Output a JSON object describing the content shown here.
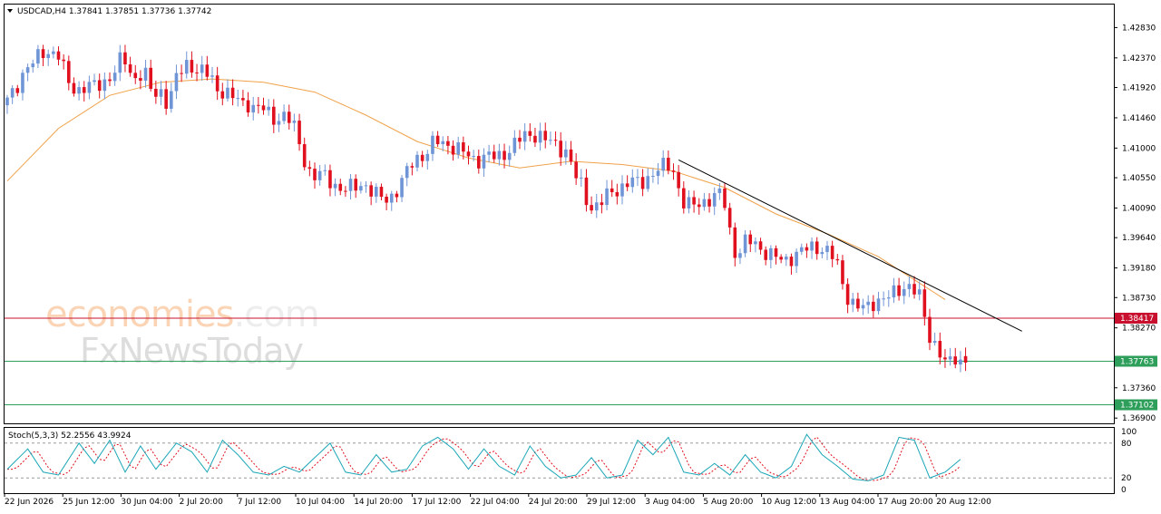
{
  "header": {
    "symbol": "USDCAD,H4",
    "open": "1.37841",
    "high": "1.37851",
    "low": "1.37736",
    "close": "1.37742"
  },
  "watermark": {
    "line1a": "economies",
    "line1b": ".com",
    "line2": "FxNewsToday"
  },
  "colors": {
    "bull": "#6f95d6",
    "bear": "#e0101e",
    "ma": "#f0a24a",
    "resistance": "#c8102e",
    "support": "#2e9e5b",
    "trendline": "#000000",
    "stoch_main": "#1aa6b7",
    "stoch_signal": "#e0101e"
  },
  "chart_data": {
    "type": "candlestick",
    "symbol": "USDCAD",
    "timeframe": "H4",
    "x_tick_labels": [
      "22 Jun 2026",
      "25 Jun 12:00",
      "30 Jun 04:00",
      "2 Jul 20:00",
      "7 Jul 12:00",
      "10 Jul 04:00",
      "14 Jul 20:00",
      "17 Jul 12:00",
      "22 Jul 04:00",
      "24 Jul 20:00",
      "29 Jul 12:00",
      "3 Aug 04:00",
      "5 Aug 20:00",
      "10 Aug 12:00",
      "13 Aug 04:00",
      "17 Aug 20:00",
      "20 Aug 12:00"
    ],
    "y_tick_labels": [
      "1.42830",
      "1.42370",
      "1.41920",
      "1.41460",
      "1.41000",
      "1.40550",
      "1.40090",
      "1.39640",
      "1.39180",
      "1.38730",
      "1.38270",
      "1.37360",
      "1.36900"
    ],
    "ylim": [
      1.3682,
      1.4318
    ],
    "price_path": [
      [
        0,
        1.4165
      ],
      [
        2,
        1.4188
      ],
      [
        4,
        1.4222
      ],
      [
        6,
        1.4232
      ],
      [
        8,
        1.4248
      ],
      [
        10,
        1.4245
      ],
      [
        11,
        1.4238
      ],
      [
        12,
        1.42
      ],
      [
        14,
        1.4188
      ],
      [
        16,
        1.4195
      ],
      [
        18,
        1.4192
      ],
      [
        20,
        1.4205
      ],
      [
        22,
        1.4222
      ],
      [
        23,
        1.424
      ],
      [
        25,
        1.4205
      ],
      [
        26,
        1.4212
      ],
      [
        27,
        1.4215
      ],
      [
        28,
        1.4205
      ],
      [
        29,
        1.417
      ],
      [
        30,
        1.419
      ],
      [
        31,
        1.4182
      ],
      [
        32,
        1.4165
      ],
      [
        33,
        1.42
      ],
      [
        35,
        1.4222
      ],
      [
        36,
        1.4232
      ],
      [
        37,
        1.4218
      ],
      [
        38,
        1.4222
      ],
      [
        39,
        1.421
      ],
      [
        40,
        1.4212
      ],
      [
        41,
        1.4195
      ],
      [
        42,
        1.4182
      ],
      [
        43,
        1.4195
      ],
      [
        44,
        1.4172
      ],
      [
        45,
        1.418
      ],
      [
        46,
        1.4165
      ],
      [
        48,
        1.417
      ],
      [
        49,
        1.4158
      ],
      [
        50,
        1.4165
      ],
      [
        51,
        1.4152
      ],
      [
        52,
        1.415
      ],
      [
        53,
        1.414
      ],
      [
        54,
        1.4155
      ],
      [
        55,
        1.4145
      ],
      [
        56,
        1.414
      ],
      [
        57,
        1.412
      ],
      [
        58,
        1.4092
      ],
      [
        60,
        1.4055
      ],
      [
        62,
        1.406
      ],
      [
        64,
        1.4048
      ],
      [
        66,
        1.4035
      ],
      [
        68,
        1.404
      ],
      [
        70,
        1.4048
      ],
      [
        72,
        1.403
      ],
      [
        74,
        1.4022
      ],
      [
        76,
        1.403
      ],
      [
        78,
        1.4055
      ],
      [
        80,
        1.4085
      ],
      [
        82,
        1.409
      ],
      [
        84,
        1.411
      ],
      [
        86,
        1.4108
      ],
      [
        88,
        1.41
      ],
      [
        90,
        1.409
      ],
      [
        92,
        1.4082
      ],
      [
        94,
        1.4088
      ],
      [
        96,
        1.4085
      ],
      [
        98,
        1.4095
      ],
      [
        100,
        1.411
      ],
      [
        102,
        1.412
      ],
      [
        104,
        1.4122
      ],
      [
        106,
        1.411
      ],
      [
        108,
        1.4102
      ],
      [
        110,
        1.4095
      ],
      [
        111,
        1.406
      ],
      [
        112,
        1.405
      ],
      [
        113,
        1.4035
      ],
      [
        114,
        1.401
      ],
      [
        116,
        1.4015
      ],
      [
        118,
        1.403
      ],
      [
        120,
        1.404
      ],
      [
        122,
        1.405
      ],
      [
        124,
        1.4045
      ],
      [
        126,
        1.406
      ],
      [
        128,
        1.407
      ],
      [
        130,
        1.4072
      ],
      [
        131,
        1.406
      ],
      [
        132,
        1.402
      ],
      [
        134,
        1.401
      ],
      [
        136,
        1.4018
      ],
      [
        138,
        1.4025
      ],
      [
        140,
        1.403
      ],
      [
        141,
        1.4
      ],
      [
        142,
        1.395
      ],
      [
        143,
        1.3935
      ],
      [
        144,
        1.3955
      ],
      [
        146,
        1.3958
      ],
      [
        148,
        1.3945
      ],
      [
        150,
        1.3935
      ],
      [
        152,
        1.3928
      ],
      [
        154,
        1.3938
      ],
      [
        156,
        1.3945
      ],
      [
        158,
        1.395
      ],
      [
        160,
        1.3948
      ],
      [
        162,
        1.393
      ],
      [
        163,
        1.391
      ],
      [
        164,
        1.388
      ],
      [
        166,
        1.386
      ],
      [
        168,
        1.3855
      ],
      [
        170,
        1.387
      ],
      [
        172,
        1.3872
      ],
      [
        174,
        1.388
      ],
      [
        176,
        1.3895
      ],
      [
        178,
        1.388
      ],
      [
        179,
        1.3865
      ],
      [
        180,
        1.382
      ],
      [
        181,
        1.3808
      ],
      [
        182,
        1.38
      ],
      [
        183,
        1.378
      ],
      [
        184,
        1.3765
      ],
      [
        185,
        1.3782
      ],
      [
        186,
        1.378
      ],
      [
        187,
        1.3774
      ]
    ],
    "moving_average": [
      [
        0,
        1.405
      ],
      [
        10,
        1.413
      ],
      [
        20,
        1.418
      ],
      [
        30,
        1.42
      ],
      [
        40,
        1.4205
      ],
      [
        50,
        1.42
      ],
      [
        60,
        1.4185
      ],
      [
        70,
        1.415
      ],
      [
        80,
        1.411
      ],
      [
        90,
        1.4085
      ],
      [
        100,
        1.407
      ],
      [
        110,
        1.408
      ],
      [
        120,
        1.4075
      ],
      [
        130,
        1.4065
      ],
      [
        140,
        1.404
      ],
      [
        150,
        1.4
      ],
      [
        160,
        1.397
      ],
      [
        170,
        1.3935
      ],
      [
        175,
        1.391
      ],
      [
        180,
        1.3885
      ],
      [
        183,
        1.387
      ]
    ],
    "horizontal_levels": [
      {
        "label": "1.38417",
        "value": 1.38417,
        "kind": "resistance"
      },
      {
        "label": "1.37763",
        "value": 1.37763,
        "kind": "support"
      },
      {
        "label": "1.37102",
        "value": 1.37102,
        "kind": "support"
      }
    ],
    "trendline": {
      "from": [
        131,
        1.4082
      ],
      "to": [
        198,
        1.3822
      ]
    },
    "stochastic": {
      "label": "Stoch(5,3,3) 52.2556 43.9924",
      "ylim": [
        0,
        100
      ],
      "levels": [
        20,
        80
      ],
      "tick_labels": [
        "100",
        "80",
        "20",
        "0"
      ],
      "k_path": [
        [
          0,
          35
        ],
        [
          4,
          70
        ],
        [
          7,
          30
        ],
        [
          10,
          25
        ],
        [
          14,
          80
        ],
        [
          17,
          45
        ],
        [
          20,
          85
        ],
        [
          23,
          30
        ],
        [
          26,
          75
        ],
        [
          29,
          35
        ],
        [
          33,
          80
        ],
        [
          36,
          65
        ],
        [
          39,
          30
        ],
        [
          42,
          85
        ],
        [
          45,
          60
        ],
        [
          48,
          30
        ],
        [
          51,
          25
        ],
        [
          54,
          40
        ],
        [
          57,
          30
        ],
        [
          60,
          55
        ],
        [
          63,
          80
        ],
        [
          66,
          30
        ],
        [
          69,
          25
        ],
        [
          72,
          60
        ],
        [
          75,
          30
        ],
        [
          78,
          35
        ],
        [
          81,
          75
        ],
        [
          84,
          90
        ],
        [
          87,
          70
        ],
        [
          90,
          35
        ],
        [
          93,
          70
        ],
        [
          96,
          40
        ],
        [
          99,
          25
        ],
        [
          102,
          75
        ],
        [
          105,
          40
        ],
        [
          108,
          20
        ],
        [
          111,
          25
        ],
        [
          114,
          55
        ],
        [
          117,
          20
        ],
        [
          120,
          25
        ],
        [
          123,
          85
        ],
        [
          126,
          60
        ],
        [
          129,
          90
        ],
        [
          132,
          30
        ],
        [
          135,
          25
        ],
        [
          138,
          45
        ],
        [
          141,
          25
        ],
        [
          144,
          60
        ],
        [
          147,
          30
        ],
        [
          150,
          20
        ],
        [
          153,
          40
        ],
        [
          156,
          95
        ],
        [
          159,
          60
        ],
        [
          162,
          40
        ],
        [
          165,
          18
        ],
        [
          168,
          15
        ],
        [
          171,
          25
        ],
        [
          174,
          90
        ],
        [
          177,
          85
        ],
        [
          180,
          20
        ],
        [
          183,
          30
        ],
        [
          186,
          52
        ]
      ]
    }
  }
}
